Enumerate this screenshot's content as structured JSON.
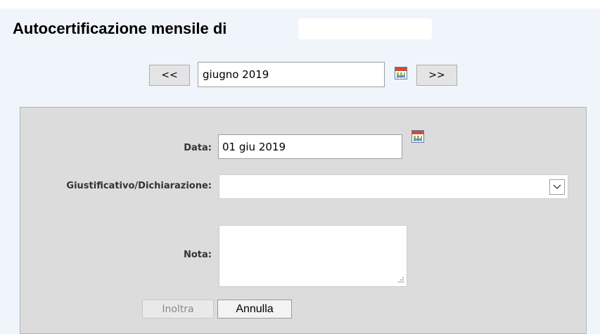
{
  "header": {
    "title": "Autocertificazione mensile di"
  },
  "month_nav": {
    "prev_label": "<<",
    "next_label": ">>",
    "month_value": "giugno 2019",
    "calendar_icon": "calendar-icon"
  },
  "form": {
    "data_label": "Data:",
    "data_value": "01 giu 2019",
    "data_calendar_icon": "calendar-icon",
    "giustificativo_label": "Giustificativo/Dichiarazione:",
    "giustificativo_value": "",
    "dropdown_icon": "chevron-down-icon",
    "nota_label": "Nota:",
    "nota_value": "",
    "submit_label": "Inoltra",
    "cancel_label": "Annulla"
  },
  "colors": {
    "page_background": "#f0f4fb",
    "panel_background": "#dcdcdc",
    "disabled_text": "#8a8a8a"
  }
}
